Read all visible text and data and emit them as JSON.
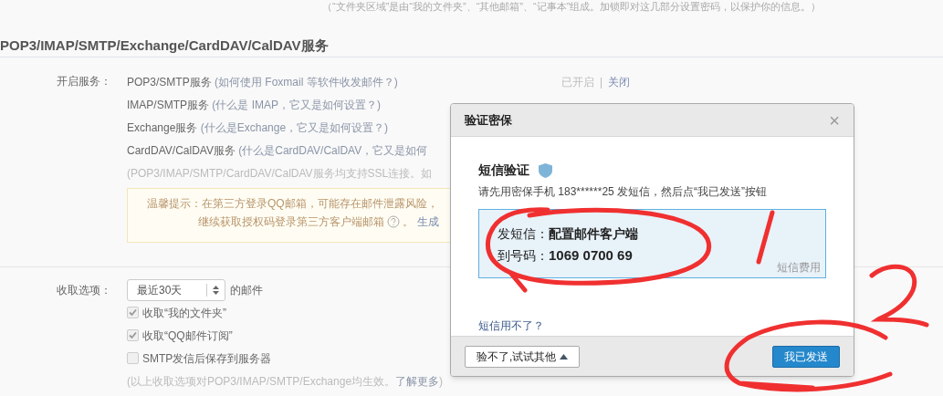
{
  "top_note": "（“文件夹区域”是由“我的文件夹”、“其他邮箱”、“记事本”组成。加锁即对这几部分设置密码，以保护你的信息。）",
  "section_title": "POP3/IMAP/SMTP/Exchange/CardDAV/CalDAV服务",
  "services": {
    "label": "开启服务：",
    "items": [
      {
        "name": "POP3/SMTP服务",
        "help": "(如何使用 Foxmail 等软件收发邮件？)",
        "status": "已开启",
        "separator": "|",
        "action": "关闭"
      },
      {
        "name": "IMAP/SMTP服务",
        "help": "(什么是 IMAP，它又是如何设置？)"
      },
      {
        "name": "Exchange服务",
        "help": "(什么是Exchange，它又是如何设置？)"
      },
      {
        "name": "CardDAV/CalDAV服务",
        "help": "(什么是CardDAV/CalDAV，它又是如何"
      }
    ],
    "ssl_note": "(POP3/IMAP/SMTP/CardDAV/CalDAV服务均支持SSL连接。如",
    "tip": {
      "line1": "温馨提示：在第三方登录QQ邮箱，可能存在邮件泄露风险，",
      "line2": "继续获取授权码登录第三方客户端邮箱",
      "line2_end": "。",
      "link": "生成"
    }
  },
  "receive": {
    "label": "收取选项：",
    "select": "最近30天",
    "select_suffix": "的邮件",
    "options": [
      {
        "label": "收取“我的文件夹”",
        "checked": true
      },
      {
        "label": "收取“QQ邮件订阅”",
        "checked": true
      },
      {
        "label": "SMTP发信后保存到服务器",
        "checked": false
      }
    ],
    "note": "(以上收取选项对POP3/IMAP/SMTP/Exchange均生效。",
    "note_link": "了解更多",
    "note_end": ")"
  },
  "dialog": {
    "title": "验证密保",
    "close": "×",
    "heading": "短信验证",
    "instruction": "请先用密保手机 183******25 发短信，然后点“我已发送”按钮",
    "sms_lines": [
      {
        "label": "发短信：",
        "value": "配置邮件客户端"
      },
      {
        "label": "到号码：",
        "value": "1069 0700 69"
      }
    ],
    "fee": "短信费用",
    "help_link": "短信用不了？",
    "other_button": "验不了,试试其他",
    "confirm_button": "我已发送"
  }
}
